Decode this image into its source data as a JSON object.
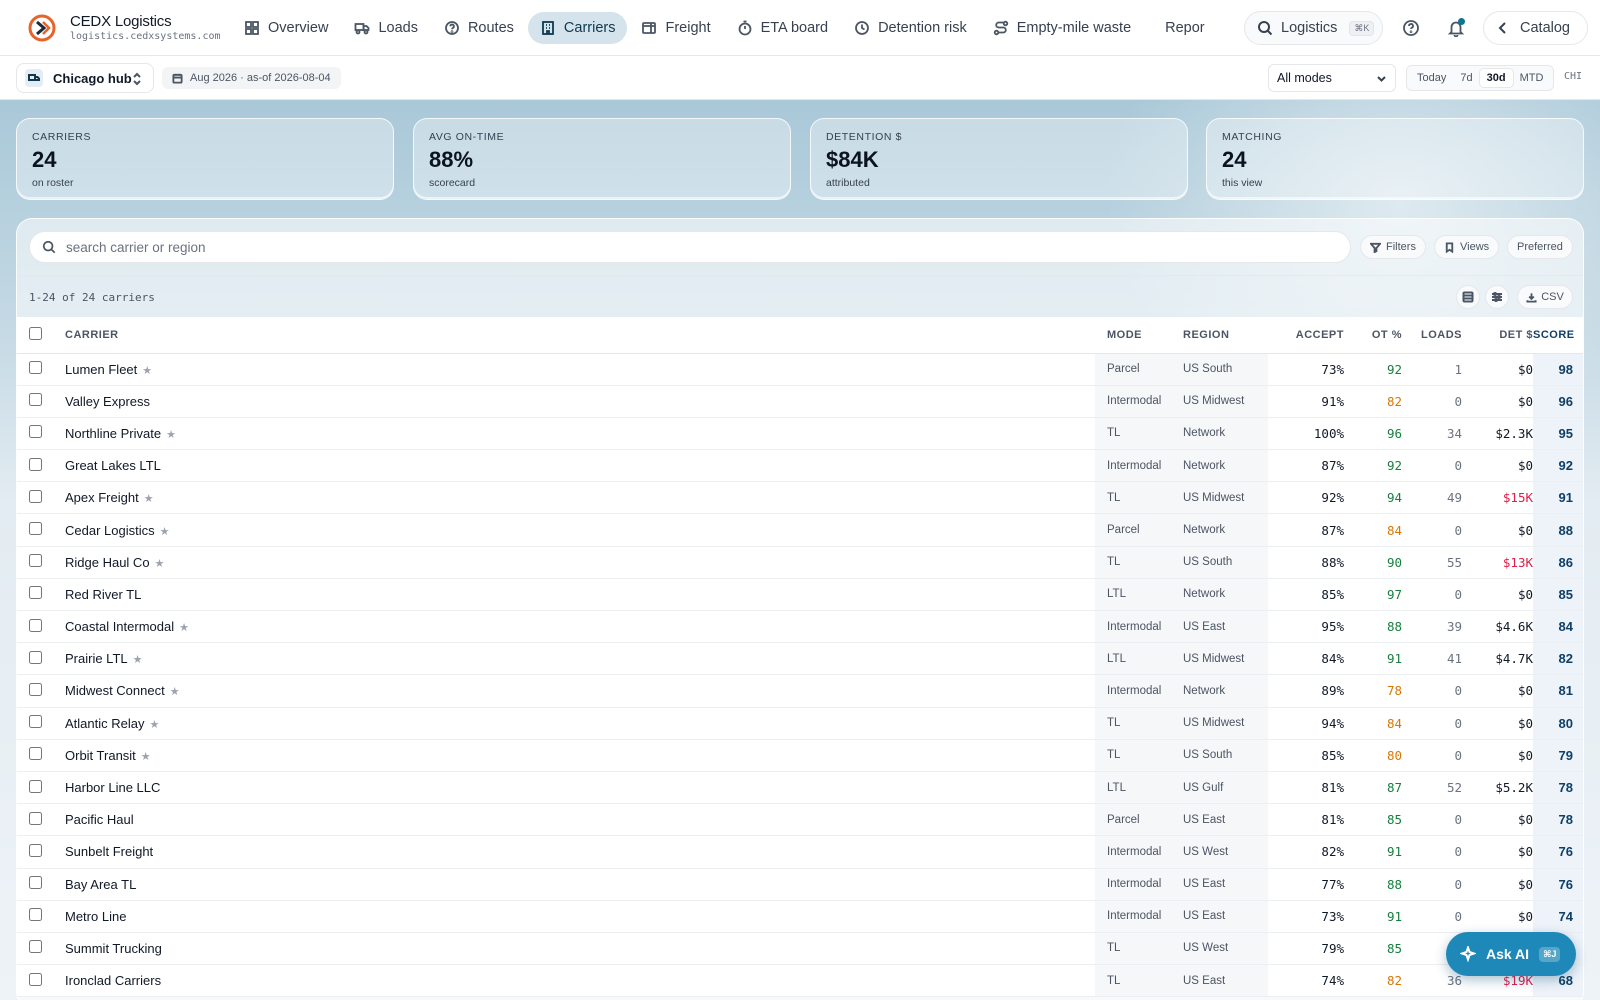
{
  "brand": {
    "name": "CEDX Logistics",
    "domain": "logistics.cedxsystems.com"
  },
  "nav": {
    "items": [
      {
        "label": "Overview",
        "icon": "grid-icon"
      },
      {
        "label": "Loads",
        "icon": "truck-icon"
      },
      {
        "label": "Routes",
        "icon": "help-circle-icon"
      },
      {
        "label": "Carriers",
        "icon": "building-icon"
      },
      {
        "label": "Freight",
        "icon": "package-icon"
      },
      {
        "label": "ETA board",
        "icon": "timer-icon"
      },
      {
        "label": "Detention risk",
        "icon": "clock-icon"
      },
      {
        "label": "Empty-mile waste",
        "icon": "route-icon"
      },
      {
        "label": "Repor",
        "icon": "bar-chart-icon"
      }
    ],
    "active": "Carriers",
    "search_label": "Logistics",
    "search_kbd": "⌘K",
    "catalog_label": "Catalog"
  },
  "subbar": {
    "hub": "Chicago hub",
    "date_range": "Aug 2026 · as-of 2026-08-04",
    "mode_select": "All modes",
    "ranges": [
      "Today",
      "7d",
      "30d",
      "MTD"
    ],
    "active_range": "30d",
    "timezone": "CHI"
  },
  "kpis": [
    {
      "label": "CARRIERS",
      "value": "24",
      "sub": "on roster"
    },
    {
      "label": "AVG ON-TIME",
      "value": "88%",
      "sub": "scorecard"
    },
    {
      "label": "DETENTION $",
      "value": "$84K",
      "sub": "attributed"
    },
    {
      "label": "MATCHING",
      "value": "24",
      "sub": "this view"
    }
  ],
  "table_panel": {
    "search_placeholder": "search carrier or region",
    "chips": [
      "Filters",
      "Views",
      "Preferred"
    ],
    "count_text": "1-24 of 24 carriers",
    "csv_label": "CSV"
  },
  "columns": [
    "CARRIER",
    "MODE",
    "REGION",
    "ACCEPT",
    "OT %",
    "LOADS",
    "DET $",
    "SCORE"
  ],
  "rows": [
    {
      "carrier": "Lumen Fleet",
      "star": true,
      "mode": "Parcel",
      "region": "US South",
      "accept": "73%",
      "ot": "92",
      "ot_status": "good",
      "loads": "1",
      "det": "$0",
      "det_status": "normal",
      "score": "98"
    },
    {
      "carrier": "Valley Express",
      "star": false,
      "mode": "Intermodal",
      "region": "US Midwest",
      "accept": "91%",
      "ot": "82",
      "ot_status": "warn",
      "loads": "0",
      "det": "$0",
      "det_status": "normal",
      "score": "96"
    },
    {
      "carrier": "Northline Private",
      "star": true,
      "mode": "TL",
      "region": "Network",
      "accept": "100%",
      "ot": "96",
      "ot_status": "good",
      "loads": "34",
      "det": "$2.3K",
      "det_status": "normal",
      "score": "95"
    },
    {
      "carrier": "Great Lakes LTL",
      "star": false,
      "mode": "Intermodal",
      "region": "Network",
      "accept": "87%",
      "ot": "92",
      "ot_status": "good",
      "loads": "0",
      "det": "$0",
      "det_status": "normal",
      "score": "92"
    },
    {
      "carrier": "Apex Freight",
      "star": true,
      "mode": "TL",
      "region": "US Midwest",
      "accept": "92%",
      "ot": "94",
      "ot_status": "good",
      "loads": "49",
      "det": "$15K",
      "det_status": "red",
      "score": "91"
    },
    {
      "carrier": "Cedar Logistics",
      "star": true,
      "mode": "Parcel",
      "region": "Network",
      "accept": "87%",
      "ot": "84",
      "ot_status": "warn",
      "loads": "0",
      "det": "$0",
      "det_status": "normal",
      "score": "88"
    },
    {
      "carrier": "Ridge Haul Co",
      "star": true,
      "mode": "TL",
      "region": "US South",
      "accept": "88%",
      "ot": "90",
      "ot_status": "good",
      "loads": "55",
      "det": "$13K",
      "det_status": "red",
      "score": "86"
    },
    {
      "carrier": "Red River TL",
      "star": false,
      "mode": "LTL",
      "region": "Network",
      "accept": "85%",
      "ot": "97",
      "ot_status": "good",
      "loads": "0",
      "det": "$0",
      "det_status": "normal",
      "score": "85"
    },
    {
      "carrier": "Coastal Intermodal",
      "star": true,
      "mode": "Intermodal",
      "region": "US East",
      "accept": "95%",
      "ot": "88",
      "ot_status": "good",
      "loads": "39",
      "det": "$4.6K",
      "det_status": "normal",
      "score": "84"
    },
    {
      "carrier": "Prairie LTL",
      "star": true,
      "mode": "LTL",
      "region": "US Midwest",
      "accept": "84%",
      "ot": "91",
      "ot_status": "good",
      "loads": "41",
      "det": "$4.7K",
      "det_status": "normal",
      "score": "82"
    },
    {
      "carrier": "Midwest Connect",
      "star": true,
      "mode": "Intermodal",
      "region": "Network",
      "accept": "89%",
      "ot": "78",
      "ot_status": "warn",
      "loads": "0",
      "det": "$0",
      "det_status": "normal",
      "score": "81"
    },
    {
      "carrier": "Atlantic Relay",
      "star": true,
      "mode": "TL",
      "region": "US Midwest",
      "accept": "94%",
      "ot": "84",
      "ot_status": "warn",
      "loads": "0",
      "det": "$0",
      "det_status": "normal",
      "score": "80"
    },
    {
      "carrier": "Orbit Transit",
      "star": true,
      "mode": "TL",
      "region": "US South",
      "accept": "85%",
      "ot": "80",
      "ot_status": "warn",
      "loads": "0",
      "det": "$0",
      "det_status": "normal",
      "score": "79"
    },
    {
      "carrier": "Harbor Line LLC",
      "star": false,
      "mode": "LTL",
      "region": "US Gulf",
      "accept": "81%",
      "ot": "87",
      "ot_status": "good",
      "loads": "52",
      "det": "$5.2K",
      "det_status": "normal",
      "score": "78"
    },
    {
      "carrier": "Pacific Haul",
      "star": false,
      "mode": "Parcel",
      "region": "US East",
      "accept": "81%",
      "ot": "85",
      "ot_status": "good",
      "loads": "0",
      "det": "$0",
      "det_status": "normal",
      "score": "78"
    },
    {
      "carrier": "Sunbelt Freight",
      "star": false,
      "mode": "Intermodal",
      "region": "US West",
      "accept": "82%",
      "ot": "91",
      "ot_status": "good",
      "loads": "0",
      "det": "$0",
      "det_status": "normal",
      "score": "76"
    },
    {
      "carrier": "Bay Area TL",
      "star": false,
      "mode": "Intermodal",
      "region": "US East",
      "accept": "77%",
      "ot": "88",
      "ot_status": "good",
      "loads": "0",
      "det": "$0",
      "det_status": "normal",
      "score": "76"
    },
    {
      "carrier": "Metro Line",
      "star": false,
      "mode": "Intermodal",
      "region": "US East",
      "accept": "73%",
      "ot": "91",
      "ot_status": "good",
      "loads": "0",
      "det": "$0",
      "det_status": "normal",
      "score": "74"
    },
    {
      "carrier": "Summit Trucking",
      "star": false,
      "mode": "TL",
      "region": "US West",
      "accept": "79%",
      "ot": "85",
      "ot_status": "good",
      "loads": "41",
      "det": "",
      "det_status": "normal",
      "score": ""
    },
    {
      "carrier": "Ironclad Carriers",
      "star": false,
      "mode": "TL",
      "region": "US East",
      "accept": "74%",
      "ot": "82",
      "ot_status": "warn",
      "loads": "36",
      "det": "$19K",
      "det_status": "red",
      "score": "68"
    }
  ],
  "ask_ai": {
    "label": "Ask AI",
    "kbd": "⌘J"
  },
  "colors": {
    "accent": "#1e88b8",
    "nav_active": "#d4e3ec",
    "ot_good": "#15803d",
    "ot_warn": "#d97706",
    "det_red": "#e11d48",
    "score": "#0f3f66"
  }
}
